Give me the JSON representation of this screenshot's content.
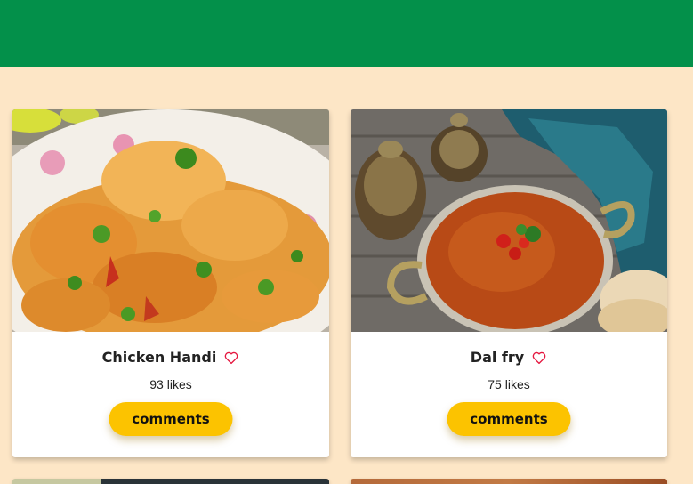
{
  "colors": {
    "header": "#03904a",
    "background": "#fde6c6",
    "button": "#fcc300",
    "heart": "#e5173f"
  },
  "cards": [
    {
      "title": "Chicken Handi",
      "likes": "93 likes",
      "button_label": "comments",
      "image": "chicken-handi-photo",
      "icon": "heart-outline-icon"
    },
    {
      "title": "Dal fry",
      "likes": "75 likes",
      "button_label": "comments",
      "image": "dal-fry-photo",
      "icon": "heart-outline-icon"
    }
  ]
}
